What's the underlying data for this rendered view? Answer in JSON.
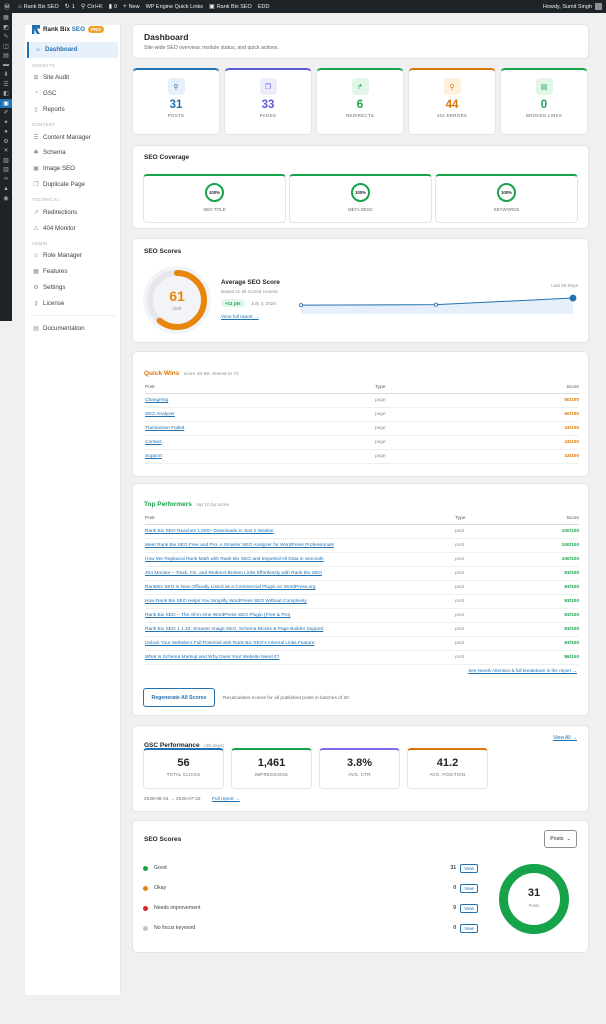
{
  "adminbar": {
    "site": "Rank Bix SEO",
    "updates": "1",
    "search": "Ctrl+K",
    "comments": "0",
    "new": "New",
    "wpengine": "WP Engine Quick Links",
    "plugin": "Rank Bix SEO",
    "edd": "EDD",
    "howdy": "Howdy, Sumit Singh"
  },
  "brand": {
    "name_a": "Rank Bix ",
    "name_b": "SEO",
    "badge": "PRO"
  },
  "nav": {
    "dashboard": "Dashboard",
    "sec_insights": "INSIGHTS",
    "site_audit": "Site Audit",
    "gsc": "GSC",
    "reports": "Reports",
    "sec_content": "CONTENT",
    "content_manager": "Content Manager",
    "schema": "Schema",
    "image_seo": "Image SEO",
    "duplicate_page": "Duplicate Page",
    "sec_technical": "TECHNICAL",
    "redirections": "Redirections",
    "monitor404": "404 Monitor",
    "sec_admin": "ADMIN",
    "role_manager": "Role Manager",
    "features": "Features",
    "settings": "Settings",
    "license": "License",
    "documentation": "Documentation"
  },
  "header": {
    "title": "Dashboard",
    "subtitle": "Site-wide SEO overview, module status, and quick actions."
  },
  "stats": [
    {
      "value": "31",
      "label": "POSTS",
      "color": "#2271b1",
      "bg": "#e6effa",
      "icon": "search-doc-icon"
    },
    {
      "value": "33",
      "label": "PAGES",
      "color": "#5b5bd6",
      "bg": "#ecebfb",
      "icon": "pages-icon"
    },
    {
      "value": "6",
      "label": "REDIRECTS",
      "color": "#16a34a",
      "bg": "#e3f6ea",
      "icon": "redirect-arrow-icon"
    },
    {
      "value": "44",
      "label": "404 ERRORS",
      "color": "#d97706",
      "bg": "#fdf0dc",
      "icon": "broken-pin-icon"
    },
    {
      "value": "0",
      "label": "BROKEN LINKS",
      "color": "#16a34a",
      "bg": "#e3f6ea",
      "icon": "link-doc-icon"
    }
  ],
  "coverage": {
    "title": "SEO Coverage",
    "items": [
      {
        "pct": "100%",
        "label": "SEO TITLE"
      },
      {
        "pct": "100%",
        "label": "META DESC"
      },
      {
        "pct": "100%",
        "label": "KEYWORDS"
      }
    ]
  },
  "scores": {
    "title": "SEO Scores",
    "value": "61",
    "of": "/100",
    "value_fraction": 0.61,
    "avg_title": "Average SEO Score",
    "avg_sub": "Based on all scored content",
    "delta": "+11 pts",
    "date": "July 3, 2026",
    "link": "View full report →",
    "range": "Last 28 Days",
    "trend": [
      30,
      32,
      61
    ]
  },
  "quickwins": {
    "title": "Quick Wins",
    "sub": "score 40-69, closest to 70",
    "cols": [
      "Post",
      "Type",
      "Score"
    ],
    "rows": [
      {
        "post": "Changelog",
        "type": "page",
        "score": "50/100"
      },
      {
        "post": "SEO Analyzer",
        "type": "page",
        "score": "50/100"
      },
      {
        "post": "Transaction Failed",
        "type": "page",
        "score": "43/100"
      },
      {
        "post": "Contact",
        "type": "page",
        "score": "43/100"
      },
      {
        "post": "Support",
        "type": "page",
        "score": "43/100"
      }
    ]
  },
  "top": {
    "title": "Top Performers",
    "sub": "top 10 by score",
    "cols": [
      "Post",
      "Type",
      "Score"
    ],
    "rows": [
      {
        "post": "Rank Bix SEO Reaches 1,000+ Downloads in Just 2 Weeks!",
        "type": "post",
        "score": "100/100"
      },
      {
        "post": "Meet Rank Bix SEO Free and Pro: A Smarter SEO Analyzer for WordPress Professionals",
        "type": "post",
        "score": "100/100"
      },
      {
        "post": "How We Replaced Rank Math with Rank Bix SEO and Imported All Data in Seconds",
        "type": "post",
        "score": "100/100"
      },
      {
        "post": "404 Monitor – Track, Fix, and Redirect Broken Links Effortlessly with Rank Bix SEO",
        "type": "post",
        "score": "93/100"
      },
      {
        "post": "RankBix SEO is Now Officially Listed as a Commercial Plugin on WordPress.org",
        "type": "post",
        "score": "93/100"
      },
      {
        "post": "How Rank Bix SEO Helps You Simplify WordPress SEO Without Complexity",
        "type": "post",
        "score": "93/100"
      },
      {
        "post": "Rank Bix SEO – The All-in-One WordPress SEO Plugin (Free & Pro)",
        "type": "post",
        "score": "93/100"
      },
      {
        "post": "Rank Bix SEO 1.1.10: Smarter Image SEO, Schema Blocks & Page Builder Support",
        "type": "post",
        "score": "93/100"
      },
      {
        "post": "Unlock Your Website's Full Potential with Rank Bix SEO's Internal Links Feature",
        "type": "post",
        "score": "93/100"
      },
      {
        "post": "What Is Schema Markup and Why Does Your Website Need It?",
        "type": "post",
        "score": "86/100"
      }
    ],
    "footer_link": "See Needs Attention & full breakdown in the report →",
    "button": "Regenerate All Scores",
    "button_note": "Recalculates scores for all published posts in batches of 20."
  },
  "gsc": {
    "title": "GSC Performance",
    "sub": "(28 days)",
    "view_all": "View All →",
    "items": [
      {
        "value": "56",
        "label": "TOTAL CLICKS",
        "color": "#2271b1"
      },
      {
        "value": "1,461",
        "label": "IMPRESSIONS",
        "color": "#16a34a"
      },
      {
        "value": "3.8%",
        "label": "AVG. CTR",
        "color": "#7c6cf0"
      },
      {
        "value": "41.2",
        "label": "AVG. POSITION",
        "color": "#d97706"
      }
    ],
    "range": "2026-06-24 → 2026-07-22",
    "report": "Full report →"
  },
  "dist": {
    "title": "SEO Scores",
    "select": "Posts",
    "total": "31",
    "total_label": "Posts",
    "rows": [
      {
        "label": "Good",
        "count": "31",
        "color": "#16a34a",
        "view": "View"
      },
      {
        "label": "Okay",
        "count": "0",
        "color": "#e8860c",
        "view": "View"
      },
      {
        "label": "Needs improvement",
        "count": "0",
        "color": "#dc2626",
        "view": "View"
      },
      {
        "label": "No focus keyword",
        "count": "0",
        "color": "#c3c4c7",
        "view": "View"
      }
    ]
  }
}
